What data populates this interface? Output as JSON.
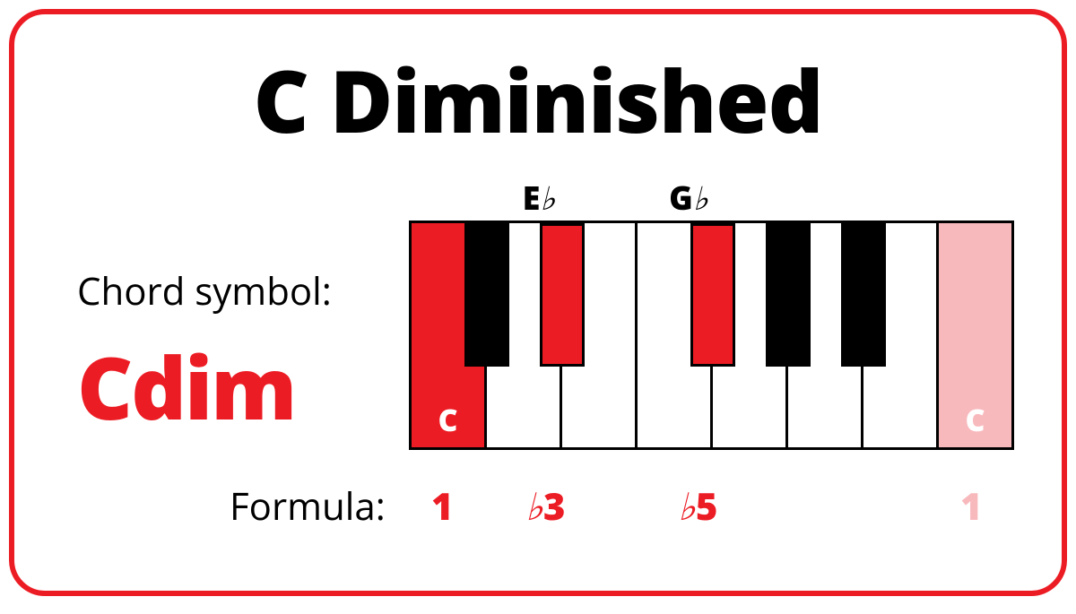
{
  "title": "C Diminished",
  "chord_label": "Chord symbol:",
  "chord_symbol": "Cdim",
  "formula_label": "Formula:",
  "colors": {
    "accent": "#ec1c24",
    "accent_light": "#f8b9bd"
  },
  "keyboard": {
    "white_keys": [
      {
        "note": "C",
        "highlighted": true,
        "label": "C",
        "label_light": false
      },
      {
        "note": "D",
        "highlighted": false,
        "label": "",
        "label_light": false
      },
      {
        "note": "E",
        "highlighted": false,
        "label": "",
        "label_light": false
      },
      {
        "note": "F",
        "highlighted": false,
        "label": "",
        "label_light": false
      },
      {
        "note": "G",
        "highlighted": false,
        "label": "",
        "label_light": false
      },
      {
        "note": "A",
        "highlighted": false,
        "label": "",
        "label_light": false
      },
      {
        "note": "B",
        "highlighted": false,
        "label": "",
        "label_light": false
      },
      {
        "note": "C",
        "highlighted": "light",
        "label": "C",
        "label_light": true
      }
    ],
    "black_keys": [
      {
        "note": "C#/Db",
        "position": 0,
        "highlighted": false
      },
      {
        "note": "D#/Eb",
        "position": 1,
        "highlighted": true
      },
      {
        "note": "F#/Gb",
        "position": 3,
        "highlighted": true
      },
      {
        "note": "G#/Ab",
        "position": 4,
        "highlighted": false
      },
      {
        "note": "A#/Bb",
        "position": 5,
        "highlighted": false
      }
    ]
  },
  "top_labels": {
    "eb": {
      "letter": "E",
      "accidental": "♭"
    },
    "gb": {
      "letter": "G",
      "accidental": "♭"
    }
  },
  "formula": {
    "one": "1",
    "flat3_acc": "♭",
    "flat3_num": "3",
    "flat5_acc": "♭",
    "flat5_num": "5",
    "one_octave": "1"
  },
  "chart_data": {
    "type": "diagram",
    "chord": "Cdim",
    "chord_name": "C Diminished",
    "notes": [
      "C",
      "Eb",
      "Gb"
    ],
    "intervals": [
      "1",
      "b3",
      "b5"
    ],
    "octave_note": "C"
  }
}
